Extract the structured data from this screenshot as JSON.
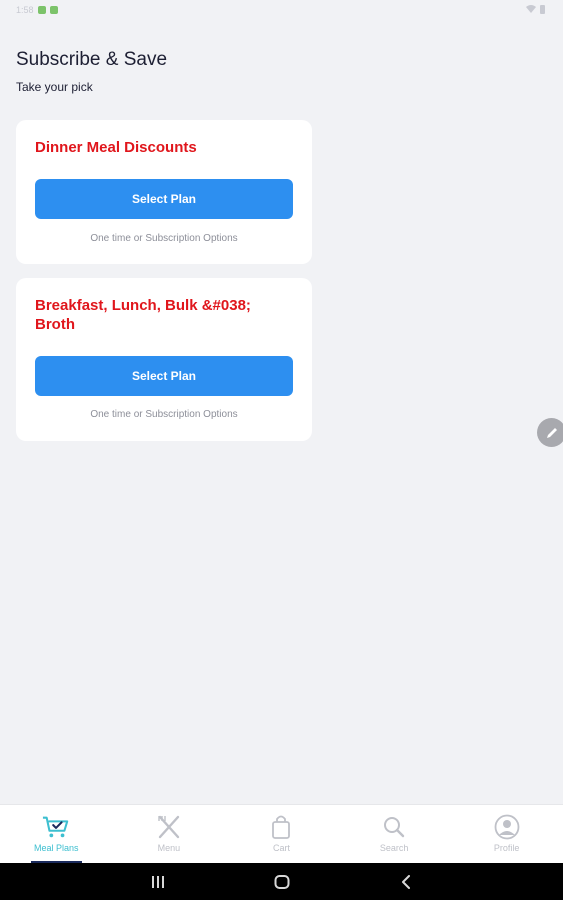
{
  "status_bar": {
    "time": "1:58",
    "left_icons": [
      "android-icon",
      "android-icon"
    ],
    "right_icons": [
      "wifi-icon",
      "battery-icon"
    ]
  },
  "header": {
    "title": "Subscribe & Save",
    "subtitle": "Take your pick"
  },
  "plans": [
    {
      "title": "Dinner Meal Discounts",
      "button_label": "Select Plan",
      "note": "One time or Subscription Options"
    },
    {
      "title": "Breakfast, Lunch, Bulk &#038; Broth",
      "button_label": "Select Plan",
      "note": "One time or Subscription Options"
    }
  ],
  "fab": {
    "icon": "pencil-icon"
  },
  "bottom_nav": {
    "items": [
      {
        "label": "Meal Plans",
        "icon": "cart-check-icon",
        "active": true
      },
      {
        "label": "Menu",
        "icon": "fork-knife-icon",
        "active": false
      },
      {
        "label": "Cart",
        "icon": "bag-icon",
        "active": false
      },
      {
        "label": "Search",
        "icon": "search-icon",
        "active": false
      },
      {
        "label": "Profile",
        "icon": "profile-icon",
        "active": false
      }
    ]
  },
  "system_nav": {
    "buttons": [
      "recents-icon",
      "home-icon",
      "back-icon"
    ]
  },
  "colors": {
    "background": "#f1f2f5",
    "card": "#ffffff",
    "plan_title": "#e0161c",
    "button": "#2d8ff0",
    "nav_active": "#3dbfd0",
    "nav_inactive": "#bfc1c8",
    "nav_indicator": "#1a2a5c"
  }
}
